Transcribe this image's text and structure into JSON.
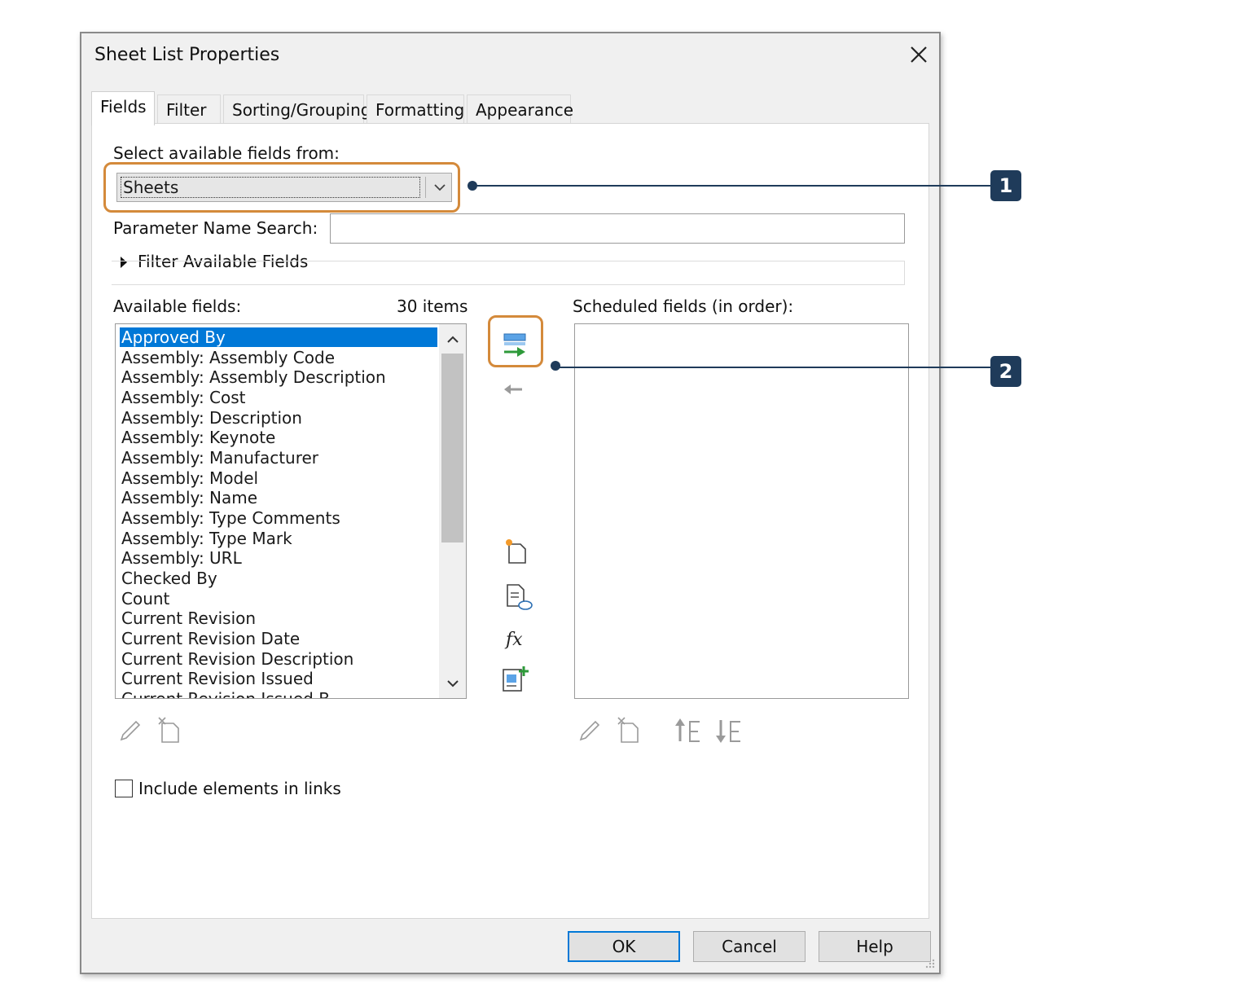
{
  "dialog": {
    "title": "Sheet List Properties",
    "tabs": [
      {
        "label": "Fields",
        "active": true
      },
      {
        "label": "Filter",
        "active": false
      },
      {
        "label": "Sorting/Grouping",
        "active": false
      },
      {
        "label": "Formatting",
        "active": false
      },
      {
        "label": "Appearance",
        "active": false
      }
    ]
  },
  "fields_tab": {
    "select_label": "Select available fields from:",
    "select_value": "Sheets",
    "param_search_label": "Parameter Name Search:",
    "param_search_value": "",
    "filter_toggle_label": "Filter Available Fields",
    "available_label": "Available fields:",
    "item_count": "30 items",
    "scheduled_label": "Scheduled fields (in order):",
    "available_fields": [
      "Approved By",
      "Assembly: Assembly Code",
      "Assembly: Assembly Description",
      "Assembly: Cost",
      "Assembly: Description",
      "Assembly: Keynote",
      "Assembly: Manufacturer",
      "Assembly: Model",
      "Assembly: Name",
      "Assembly: Type Comments",
      "Assembly: Type Mark",
      "Assembly: URL",
      "Checked By",
      "Count",
      "Current Revision",
      "Current Revision Date",
      "Current Revision Description",
      "Current Revision Issued",
      "Current Revision Issued B"
    ],
    "selected_field": "Approved By",
    "scheduled_fields": [],
    "include_links_label": "Include elements in links",
    "include_links_checked": false
  },
  "buttons": {
    "ok": "OK",
    "cancel": "Cancel",
    "help": "Help"
  },
  "callouts": [
    "1",
    "2"
  ],
  "colors": {
    "accent": "#0078d7",
    "highlight": "#d48a3b",
    "callout": "#1f3b5a",
    "add_icon_green": "#2e9a3a"
  }
}
